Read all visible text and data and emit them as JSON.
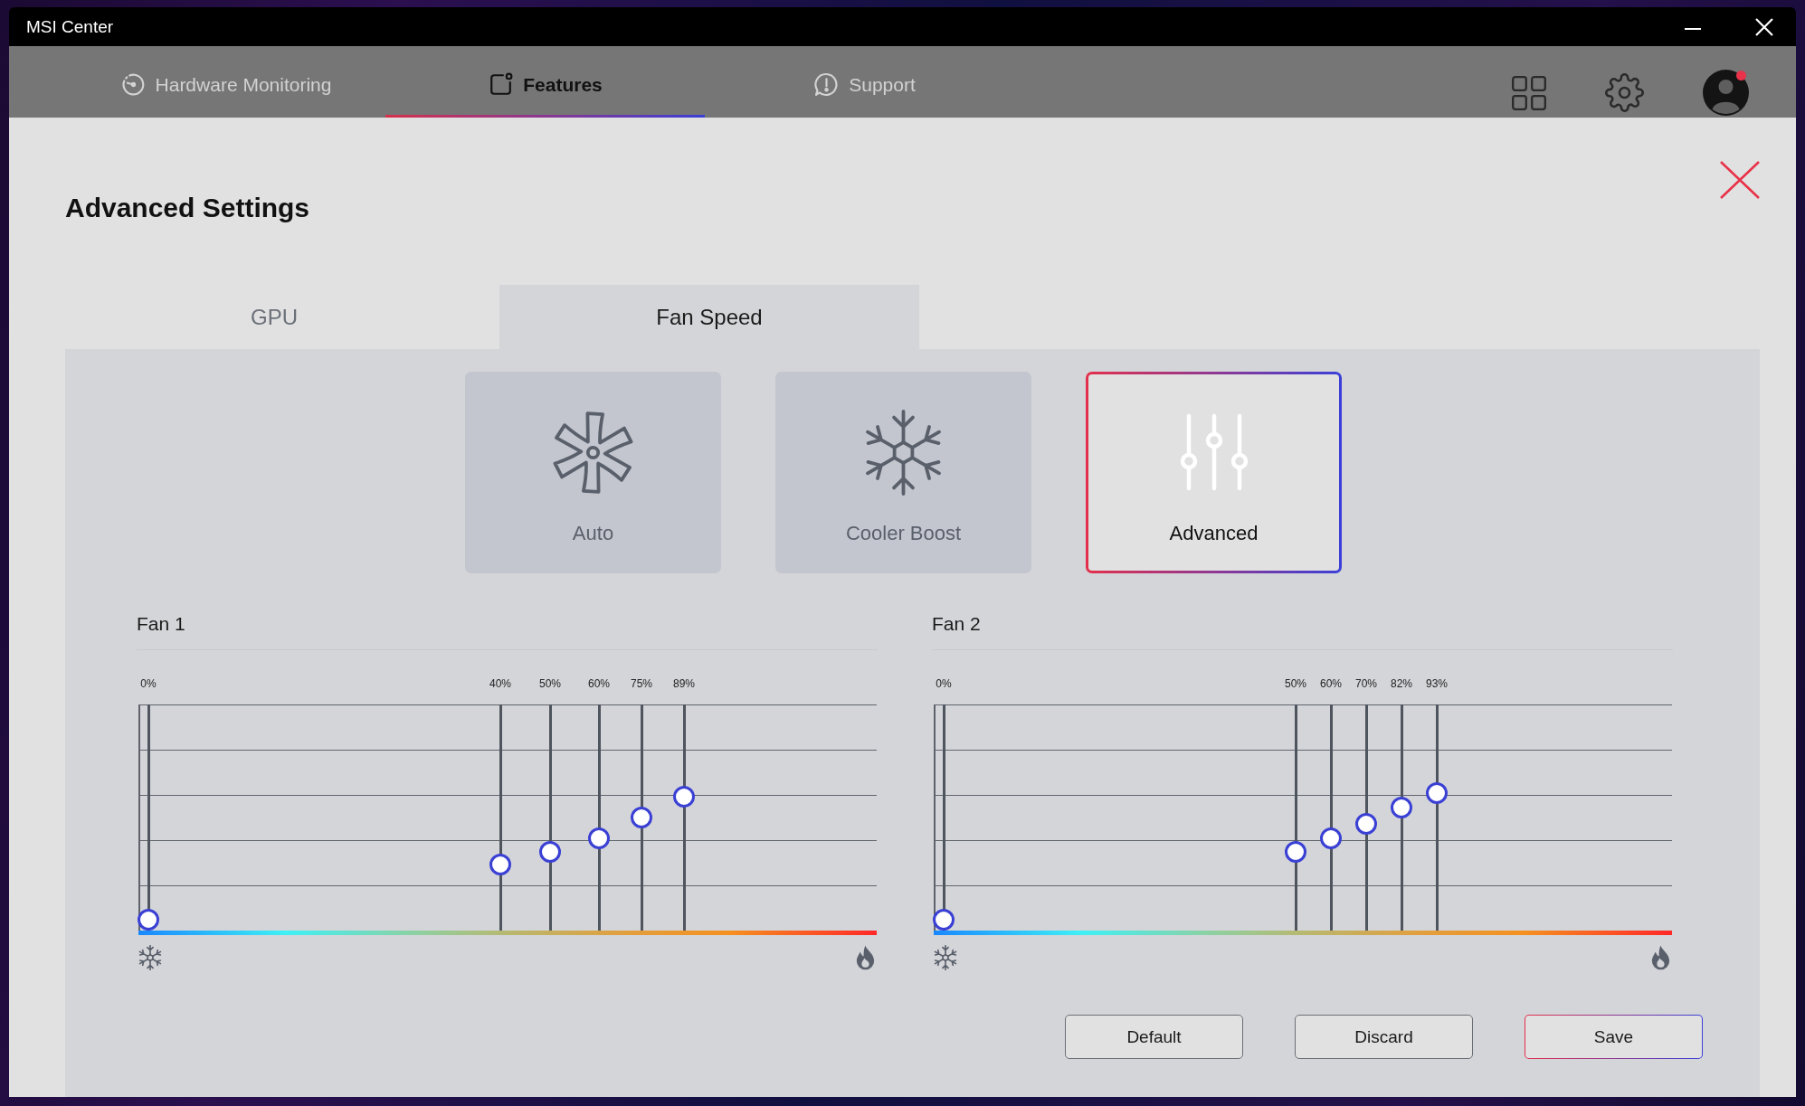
{
  "window": {
    "title": "MSI Center"
  },
  "nav_tabs": [
    {
      "label": "Hardware Monitoring",
      "selected": false
    },
    {
      "label": "Features",
      "selected": true
    },
    {
      "label": "Support",
      "selected": false
    }
  ],
  "profile": {
    "notification": true
  },
  "page": {
    "title": "Advanced Settings"
  },
  "tabs": [
    {
      "label": "GPU",
      "selected": false
    },
    {
      "label": "Fan Speed",
      "selected": true
    }
  ],
  "modes": [
    {
      "label": "Auto",
      "selected": false
    },
    {
      "label": "Cooler Boost",
      "selected": false
    },
    {
      "label": "Advanced",
      "selected": true
    }
  ],
  "fans": [
    {
      "name": "Fan 1",
      "points": [
        {
          "reading": "0%",
          "level": 0
        },
        {
          "reading": "40%",
          "level": 0.27
        },
        {
          "reading": "50%",
          "level": 0.33
        },
        {
          "reading": "60%",
          "level": 0.4
        },
        {
          "reading": "75%",
          "level": 0.5
        },
        {
          "reading": "89%",
          "level": 0.6
        }
      ]
    },
    {
      "name": "Fan 2",
      "points": [
        {
          "reading": "0%",
          "level": 0
        },
        {
          "reading": "50%",
          "level": 0.33
        },
        {
          "reading": "60%",
          "level": 0.4
        },
        {
          "reading": "70%",
          "level": 0.47
        },
        {
          "reading": "82%",
          "level": 0.55
        },
        {
          "reading": "93%",
          "level": 0.62
        }
      ]
    }
  ],
  "buttons": [
    {
      "label": "Default",
      "kind": "secondary"
    },
    {
      "label": "Discard",
      "kind": "secondary"
    },
    {
      "label": "Save",
      "kind": "primary"
    }
  ]
}
